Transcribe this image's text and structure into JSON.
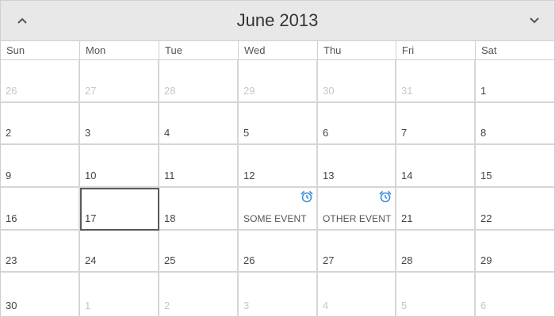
{
  "calendar": {
    "title": "June 2013",
    "prev_icon": "chevron-up-icon",
    "next_icon": "chevron-down-icon",
    "weekdays": [
      "Sun",
      "Mon",
      "Tue",
      "Wed",
      "Thu",
      "Fri",
      "Sat"
    ],
    "accent": "#3b8fdc",
    "selected_day": "17",
    "weeks": [
      [
        {
          "n": "26",
          "other": true
        },
        {
          "n": "27",
          "other": true
        },
        {
          "n": "28",
          "other": true
        },
        {
          "n": "29",
          "other": true
        },
        {
          "n": "30",
          "other": true
        },
        {
          "n": "31",
          "other": true
        },
        {
          "n": "1"
        }
      ],
      [
        {
          "n": "2"
        },
        {
          "n": "3"
        },
        {
          "n": "4"
        },
        {
          "n": "5"
        },
        {
          "n": "6"
        },
        {
          "n": "7"
        },
        {
          "n": "8"
        }
      ],
      [
        {
          "n": "9"
        },
        {
          "n": "10"
        },
        {
          "n": "11"
        },
        {
          "n": "12"
        },
        {
          "n": "13"
        },
        {
          "n": "14"
        },
        {
          "n": "15"
        }
      ],
      [
        {
          "n": "16"
        },
        {
          "n": "17",
          "selected": true
        },
        {
          "n": "18"
        },
        {
          "n": "",
          "event": "SOME EVENT",
          "icon": "alarm-clock-icon"
        },
        {
          "n": "",
          "event": "OTHER EVENT",
          "icon": "alarm-clock-icon"
        },
        {
          "n": "21"
        },
        {
          "n": "22"
        }
      ],
      [
        {
          "n": "23"
        },
        {
          "n": "24"
        },
        {
          "n": "25"
        },
        {
          "n": "26"
        },
        {
          "n": "27"
        },
        {
          "n": "28"
        },
        {
          "n": "29"
        }
      ],
      [
        {
          "n": "30"
        },
        {
          "n": "1",
          "other": true
        },
        {
          "n": "2",
          "other": true
        },
        {
          "n": "3",
          "other": true
        },
        {
          "n": "4",
          "other": true
        },
        {
          "n": "5",
          "other": true
        },
        {
          "n": "6",
          "other": true
        }
      ]
    ]
  }
}
